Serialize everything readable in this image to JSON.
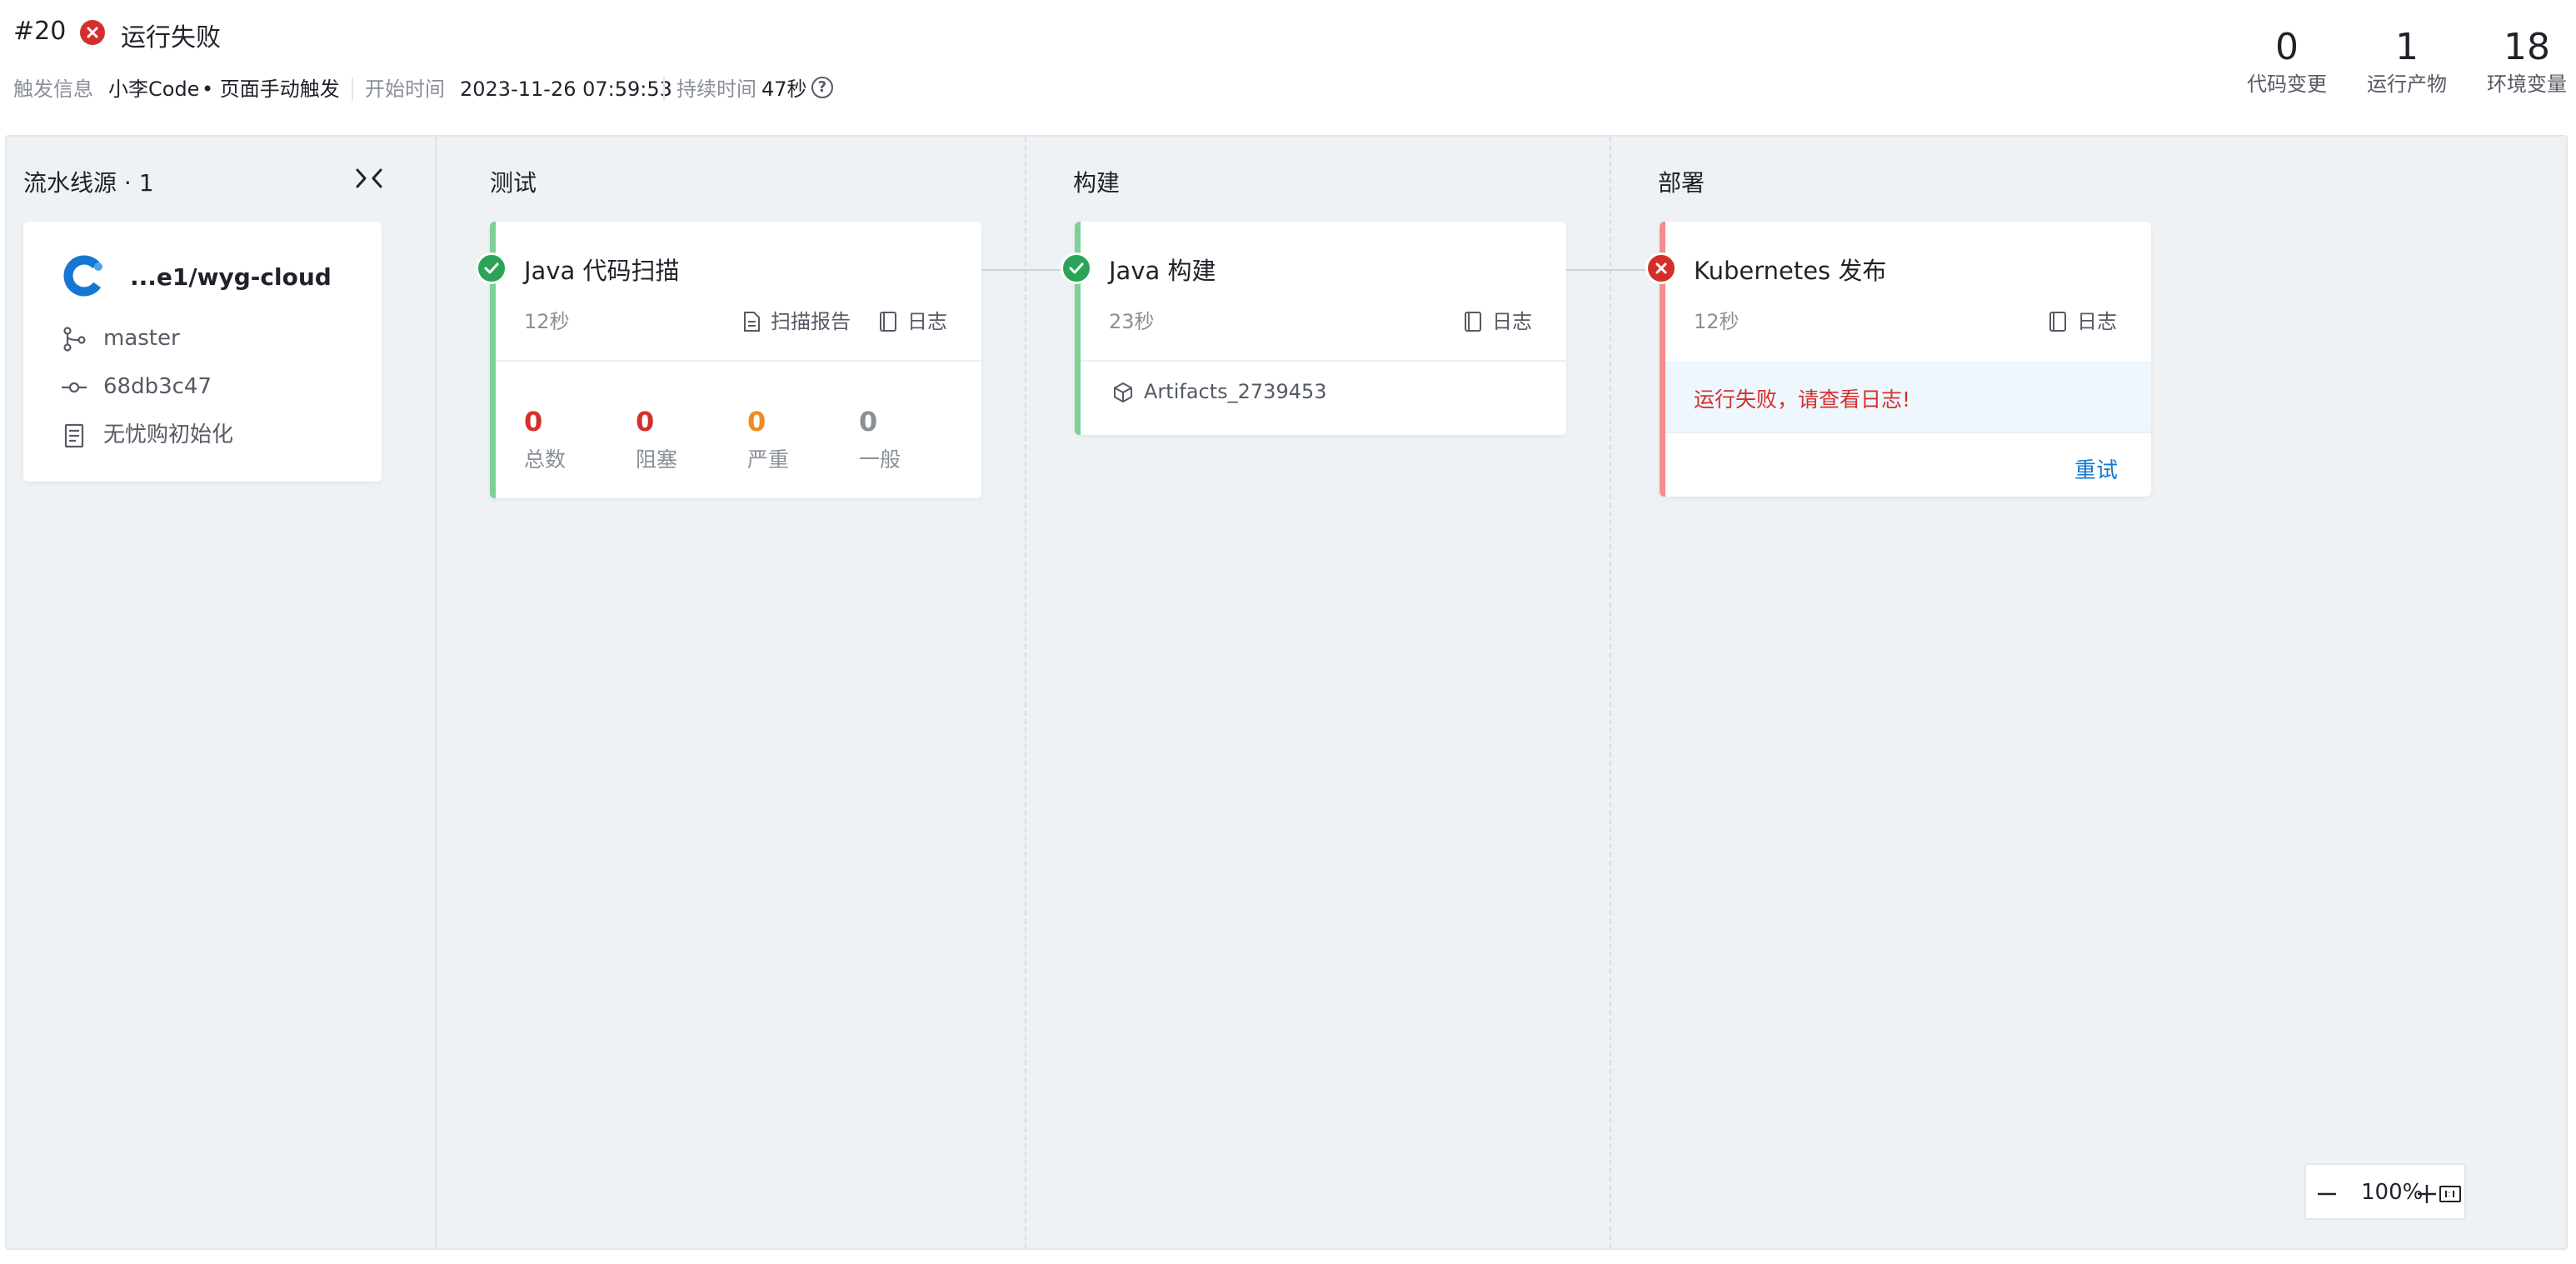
{
  "header": {
    "run_id": "#20",
    "status": "运行失败",
    "status_color": "#d4302b",
    "trigger_label": "触发信息",
    "trigger_user": "小李Code",
    "trigger_way": "• 页面手动触发",
    "start_label": "开始时间",
    "start_time": "2023-11-26 07:59:53",
    "duration_label": "持续时间",
    "duration": "47秒",
    "help_icon": "?"
  },
  "stats": [
    {
      "value": "0",
      "label": "代码变更"
    },
    {
      "value": "1",
      "label": "运行产物"
    },
    {
      "value": "18",
      "label": "环境变量"
    }
  ],
  "source": {
    "title": "流水线源 · 1",
    "repo": "...e1/wyg-cloud",
    "branch": "master",
    "commit": "68db3c47",
    "message": "无忧购初始化"
  },
  "stages": [
    {
      "name": "测试",
      "job": {
        "title": "Java 代码扫描",
        "duration": "12秒",
        "status": "success",
        "report_label": "扫描报告",
        "log_label": "日志",
        "metrics": [
          {
            "value": "0",
            "label": "总数",
            "color": "#d4302b"
          },
          {
            "value": "0",
            "label": "阻塞",
            "color": "#d4302b"
          },
          {
            "value": "0",
            "label": "严重",
            "color": "#f08a1c"
          },
          {
            "value": "0",
            "label": "一般",
            "color": "#8a8f99"
          }
        ]
      }
    },
    {
      "name": "构建",
      "job": {
        "title": "Java 构建",
        "duration": "23秒",
        "status": "success",
        "log_label": "日志",
        "artifact": "Artifacts_2739453"
      }
    },
    {
      "name": "部署",
      "job": {
        "title": "Kubernetes 发布",
        "duration": "12秒",
        "status": "failed",
        "log_label": "日志",
        "error": "运行失败，请查看日志!",
        "retry_label": "重试"
      }
    }
  ],
  "zoom": {
    "level": "100%",
    "minus": "—",
    "plus": "+"
  },
  "colors": {
    "success": "#2ba457",
    "failure": "#d4302b",
    "link": "#1677d2",
    "canvas_bg": "#eff2f5"
  }
}
